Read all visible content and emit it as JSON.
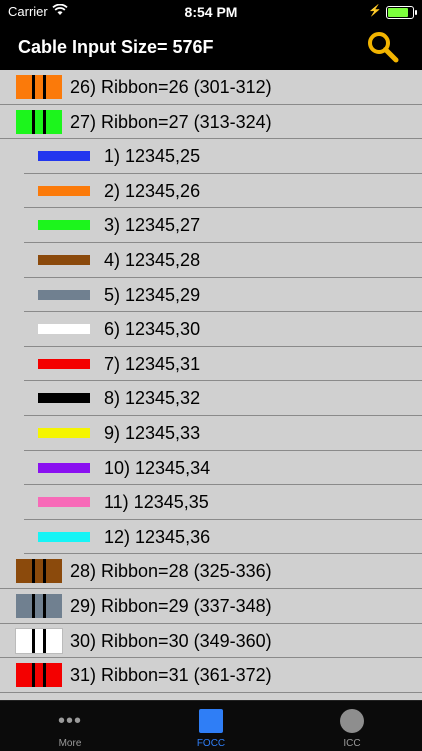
{
  "status_bar": {
    "carrier": "Carrier",
    "time": "8:54 PM"
  },
  "nav": {
    "title": "Cable Input Size= 576F",
    "search_icon": "search-icon"
  },
  "colors": {
    "orange": "#fb7a0a",
    "green": "#1cf51c",
    "blue": "#2236ee",
    "brown": "#8b4a0c",
    "slate": "#708090",
    "white": "#ffffff",
    "red": "#f40000",
    "black": "#000000",
    "yellow": "#f5f500",
    "violet": "#8a10f0",
    "rose": "#f76ab8",
    "aqua": "#16f4f6",
    "accent": "#2f7ef6"
  },
  "rows": [
    {
      "kind": "ribbon",
      "label": "26) Ribbon=26 (301-312)",
      "color": "#fb7a0a"
    },
    {
      "kind": "ribbon",
      "label": "27) Ribbon=27 (313-324)",
      "color": "#1cf51c"
    },
    {
      "kind": "fiber",
      "label": "1) 12345,25",
      "color": "#2236ee"
    },
    {
      "kind": "fiber",
      "label": "2) 12345,26",
      "color": "#fb7a0a"
    },
    {
      "kind": "fiber",
      "label": "3) 12345,27",
      "color": "#1cf51c"
    },
    {
      "kind": "fiber",
      "label": "4) 12345,28",
      "color": "#8b4a0c"
    },
    {
      "kind": "fiber",
      "label": "5) 12345,29",
      "color": "#708090"
    },
    {
      "kind": "fiber",
      "label": "6) 12345,30",
      "color": "#ffffff"
    },
    {
      "kind": "fiber",
      "label": "7) 12345,31",
      "color": "#f40000"
    },
    {
      "kind": "fiber",
      "label": "8) 12345,32",
      "color": "#000000"
    },
    {
      "kind": "fiber",
      "label": "9) 12345,33",
      "color": "#f5f500"
    },
    {
      "kind": "fiber",
      "label": "10) 12345,34",
      "color": "#8a10f0"
    },
    {
      "kind": "fiber",
      "label": "11) 12345,35",
      "color": "#f76ab8"
    },
    {
      "kind": "fiber",
      "label": "12) 12345,36",
      "color": "#16f4f6"
    },
    {
      "kind": "ribbon",
      "label": "28) Ribbon=28 (325-336)",
      "color": "#8b4a0c"
    },
    {
      "kind": "ribbon",
      "label": "29) Ribbon=29 (337-348)",
      "color": "#708090"
    },
    {
      "kind": "ribbon",
      "label": "30) Ribbon=30 (349-360)",
      "color": "#ffffff"
    },
    {
      "kind": "ribbon",
      "label": "31) Ribbon=31 (361-372)",
      "color": "#f40000"
    }
  ],
  "tabs": [
    {
      "label": "More",
      "icon": "more-icon",
      "active": false
    },
    {
      "label": "FOCC",
      "icon": "focc-icon",
      "active": true
    },
    {
      "label": "ICC",
      "icon": "icc-icon",
      "active": false
    }
  ]
}
